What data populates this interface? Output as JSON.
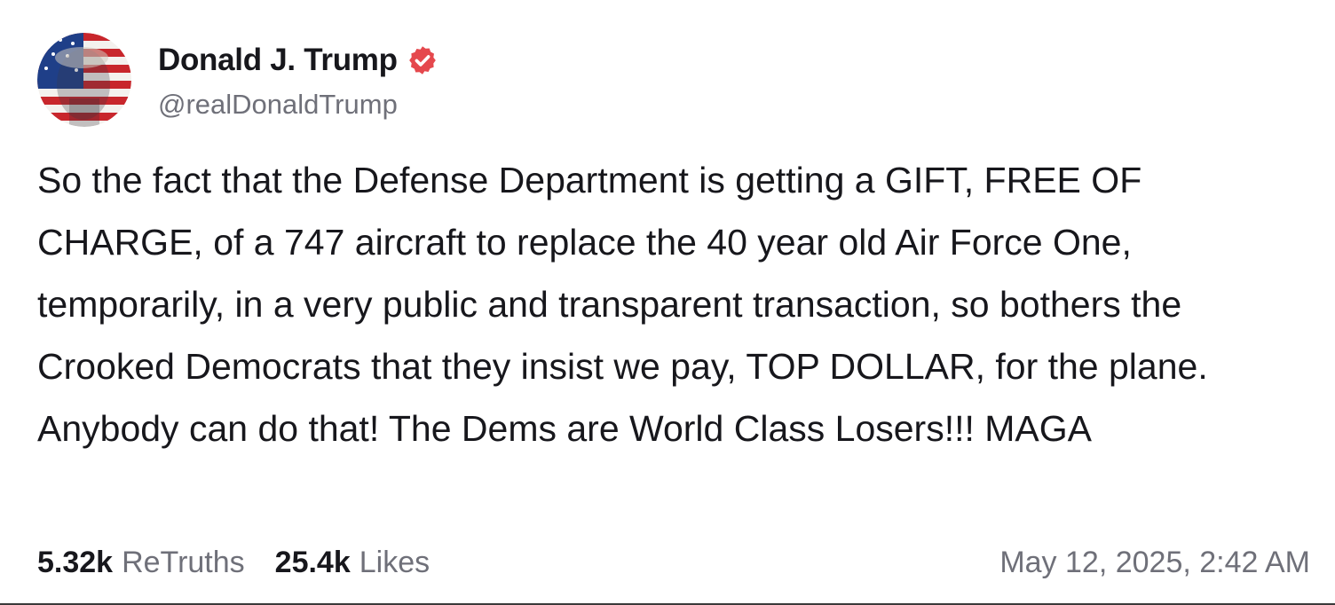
{
  "post": {
    "author": {
      "display_name": "Donald J. Trump",
      "handle": "@realDonaldTrump",
      "verified": true,
      "verified_icon": "verified-badge-icon",
      "avatar_icon": "avatar-flag-portrait"
    },
    "text": "So the fact that the Defense Department is getting a GIFT, FREE OF CHARGE, of a 747 aircraft to replace the 40 year old Air Force One, temporarily, in a very public and transparent transaction, so bothers the Crooked Democrats that they insist we pay, TOP DOLLAR, for the plane. Anybody can do that! The Dems are World Class Losers!!! MAGA",
    "stats": {
      "retruths_count": "5.32k",
      "retruths_label": "ReTruths",
      "likes_count": "25.4k",
      "likes_label": "Likes"
    },
    "timestamp": "May 12, 2025, 2:42 AM"
  },
  "colors": {
    "text_primary": "#17171c",
    "text_secondary": "#6f7079",
    "verified_badge": "#e5484d",
    "background": "#ffffff"
  }
}
